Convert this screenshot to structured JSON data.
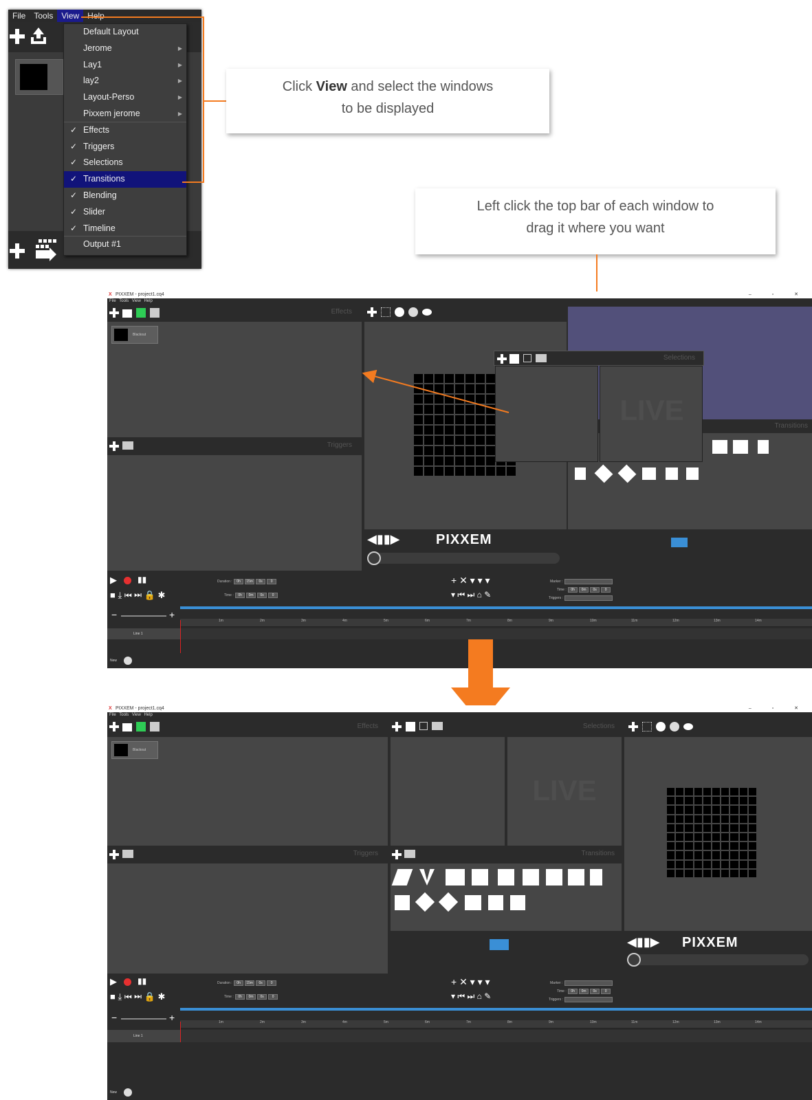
{
  "menu_bar": [
    "File",
    "Tools",
    "View",
    "Help"
  ],
  "view_menu": [
    {
      "label": "Default Layout",
      "checked": false,
      "submenu": false
    },
    {
      "label": "Jerome",
      "checked": false,
      "submenu": true
    },
    {
      "label": "Lay1",
      "checked": false,
      "submenu": true
    },
    {
      "label": "lay2",
      "checked": false,
      "submenu": true
    },
    {
      "label": "Layout-Perso",
      "checked": false,
      "submenu": true
    },
    {
      "label": "Pixxem jerome",
      "checked": false,
      "submenu": true
    },
    {
      "label": "Effects",
      "checked": true,
      "submenu": false
    },
    {
      "label": "Triggers",
      "checked": true,
      "submenu": false
    },
    {
      "label": "Selections",
      "checked": true,
      "submenu": false
    },
    {
      "label": "Transitions",
      "checked": true,
      "submenu": false,
      "selected": true
    },
    {
      "label": "Blending",
      "checked": true,
      "submenu": false
    },
    {
      "label": "Slider",
      "checked": true,
      "submenu": false
    },
    {
      "label": "Timeline",
      "checked": true,
      "submenu": false
    },
    {
      "label": "Output #1",
      "checked": false,
      "submenu": false
    }
  ],
  "callout_1": {
    "pre": "Click ",
    "bold": "View",
    "post": " and select the windows",
    "line2": "to be displayed"
  },
  "callout_2": {
    "line1": "Left click the top bar of each window to",
    "line2": "drag it where you want"
  },
  "app": {
    "window_title": "PIXXEM - project1.cq4",
    "app_menu": "File Tools View Help",
    "window_controls": "–  ▫  ✕",
    "panels": {
      "effects": "Effects",
      "triggers": "Triggers",
      "selections": "Selections",
      "transitions": "Transitions"
    },
    "blackout": "Blackout",
    "live": "LIVE",
    "brand": "PIXXEM",
    "duration_label": "Duration :",
    "time_label": "Time :",
    "marker_label": "Marker :",
    "triggers_label": "Triggers :",
    "fields": {
      "h": "0h",
      "m15": "15m",
      "m0": "0m",
      "s": "0s",
      "z": "0"
    },
    "ruler_ticks": [
      "1m",
      "2m",
      "3m",
      "4m",
      "5m",
      "6m",
      "7m",
      "8m",
      "9m",
      "10m",
      "11m",
      "12m",
      "13m",
      "14m"
    ],
    "line_label": "Line 1",
    "new_label": "New"
  },
  "colors": {
    "orange": "#f47b20",
    "menu_highlight": "#11137a",
    "output_blue": "#52507a"
  }
}
